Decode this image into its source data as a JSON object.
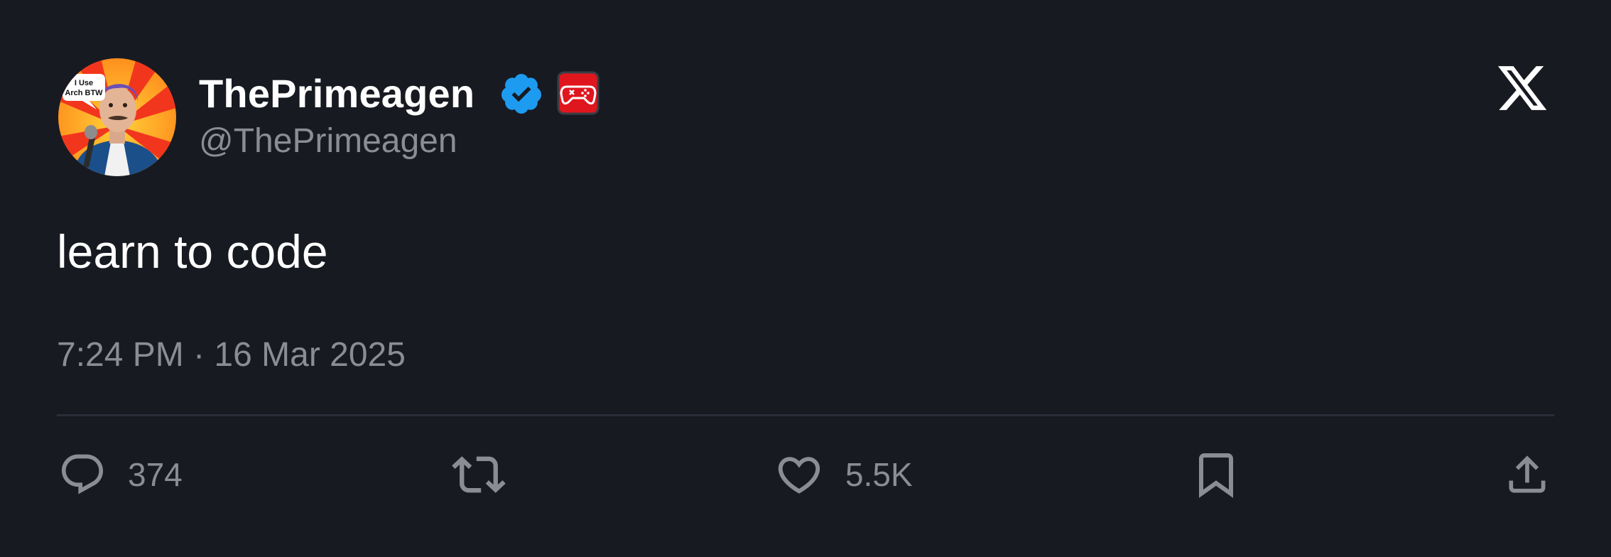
{
  "tweet": {
    "author": {
      "display_name": "ThePrimeagen",
      "handle": "@ThePrimeagen",
      "verified": true,
      "avatar_caption": "I Use Arch BTW",
      "affiliate_badge": "controller-badge-icon"
    },
    "text": "learn to code",
    "timestamp": "7:24 PM · 16 Mar 2025"
  },
  "actions": {
    "reply": {
      "icon": "reply-icon",
      "count": "374"
    },
    "retweet": {
      "icon": "retweet-icon",
      "count": ""
    },
    "like": {
      "icon": "heart-icon",
      "count": "5.5K"
    },
    "bookmark": {
      "icon": "bookmark-icon"
    },
    "share": {
      "icon": "share-icon"
    }
  },
  "brand": {
    "logo": "x-logo-icon"
  },
  "colors": {
    "background": "#181a22",
    "primary_text": "#ffffff",
    "secondary_text": "#8a8d96",
    "divider": "#2b2e37",
    "verified_blue": "#1d9bf0",
    "affiliate_red": "#e0161e"
  }
}
